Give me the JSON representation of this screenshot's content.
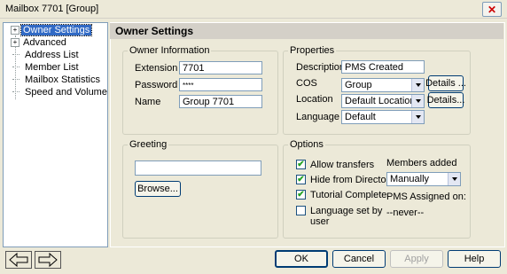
{
  "window": {
    "title": "Mailbox 7701 [Group]"
  },
  "tree": {
    "items": [
      {
        "label": "Owner Settings",
        "expandable": true,
        "selected": true
      },
      {
        "label": "Advanced",
        "expandable": true,
        "selected": false
      },
      {
        "label": "Address List",
        "expandable": false,
        "selected": false
      },
      {
        "label": "Member List",
        "expandable": false,
        "selected": false
      },
      {
        "label": "Mailbox Statistics",
        "expandable": false,
        "selected": false
      },
      {
        "label": "Speed and Volume",
        "expandable": false,
        "selected": false
      }
    ],
    "expand_glyph": "+"
  },
  "header": {
    "title": "Owner Settings"
  },
  "owner_info": {
    "legend": "Owner Information",
    "extension_label": "Extension",
    "extension_value": "7701",
    "password_label": "Password",
    "password_value": "****",
    "name_label": "Name",
    "name_value": "Group 7701"
  },
  "properties": {
    "legend": "Properties",
    "description_label": "Description",
    "description_value": "PMS Created",
    "cos_label": "COS",
    "cos_value": "Group",
    "location_label": "Location",
    "location_value": "Default Location",
    "language_label": "Language",
    "language_value": "Default",
    "details_cos_label": "Details ...",
    "details_location_label": "Details..."
  },
  "greeting": {
    "legend": "Greeting",
    "value": "",
    "browse_label": "Browse..."
  },
  "options": {
    "legend": "Options",
    "allow_transfers": {
      "label": "Allow transfers",
      "checked": true
    },
    "hide_from_directory": {
      "label": "Hide from Directory",
      "checked": true
    },
    "tutorial_complete": {
      "label": "Tutorial Complete",
      "checked": true
    },
    "language_set": {
      "label_line1": "Language set by",
      "label_line2": "user",
      "checked": false
    },
    "members_added_label": "Members added",
    "members_added_value": "Manually",
    "pms_assigned_label": "PMS Assigned on:",
    "pms_assigned_value": "--never--"
  },
  "footer": {
    "ok_label": "OK",
    "cancel_label": "Cancel",
    "apply_label": "Apply",
    "help_label": "Help"
  },
  "check_glyph": "✔",
  "close_glyph": "✕"
}
